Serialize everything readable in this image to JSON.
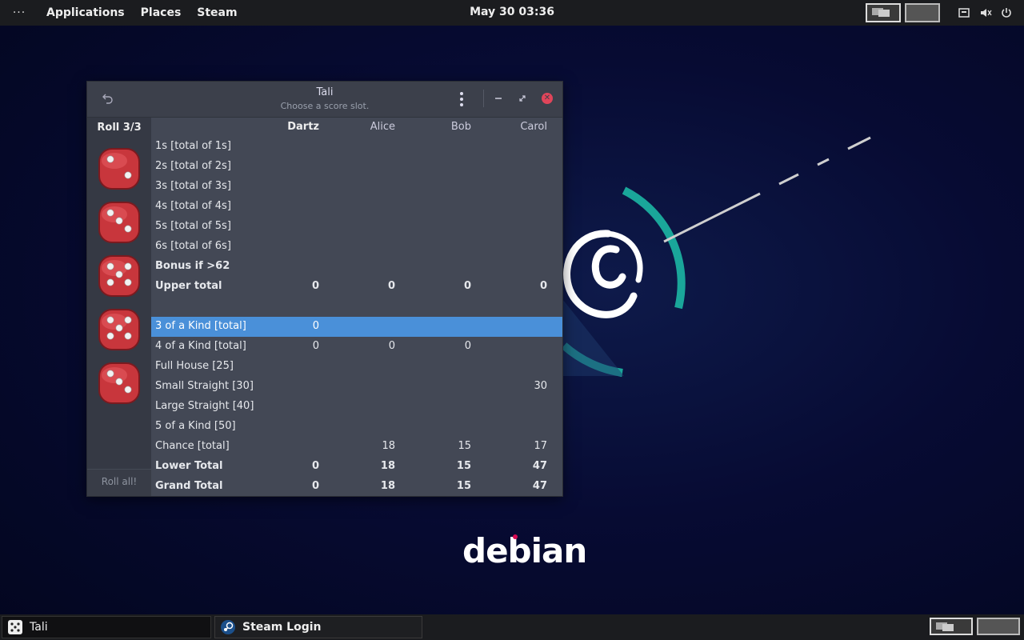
{
  "topbar": {
    "applications": "Applications",
    "places": "Places",
    "steam": "Steam",
    "clock": "May 30  03:36",
    "dots": "···"
  },
  "taskbar": {
    "tasks": [
      {
        "label": "Tali",
        "icon": "dice-icon"
      },
      {
        "label": "Steam Login",
        "icon": "steam-icon"
      }
    ]
  },
  "desktop": {
    "logo_text": "debian"
  },
  "window": {
    "title": "Tali",
    "subtitle": "Choose a score slot.",
    "roll_label": "Roll 3/3",
    "roll_all": "Roll all!",
    "players": [
      "Dartz",
      "Alice",
      "Bob",
      "Carol"
    ],
    "rows": [
      {
        "label": "1s [total of 1s]",
        "bold": false,
        "values": [
          "",
          "",
          "",
          ""
        ]
      },
      {
        "label": "2s [total of 2s]",
        "bold": false,
        "values": [
          "",
          "",
          "",
          ""
        ]
      },
      {
        "label": "3s [total of 3s]",
        "bold": false,
        "values": [
          "",
          "",
          "",
          ""
        ]
      },
      {
        "label": "4s [total of 4s]",
        "bold": false,
        "values": [
          "",
          "",
          "",
          ""
        ]
      },
      {
        "label": "5s [total of 5s]",
        "bold": false,
        "values": [
          "",
          "",
          "",
          ""
        ]
      },
      {
        "label": "6s [total of 6s]",
        "bold": false,
        "values": [
          "",
          "",
          "",
          ""
        ]
      },
      {
        "label": "Bonus if >62",
        "bold": true,
        "values": [
          "",
          "",
          "",
          ""
        ]
      },
      {
        "label": "Upper total",
        "bold": true,
        "values": [
          "0",
          "0",
          "0",
          "0"
        ]
      },
      {
        "label": "",
        "bold": false,
        "values": [
          "",
          "",
          "",
          ""
        ]
      },
      {
        "label": "3 of a Kind [total]",
        "bold": false,
        "selected": true,
        "values": [
          "0",
          "",
          "",
          ""
        ]
      },
      {
        "label": "4 of a Kind [total]",
        "bold": false,
        "values": [
          "0",
          "0",
          "0",
          ""
        ]
      },
      {
        "label": "Full House [25]",
        "bold": false,
        "values": [
          "",
          "",
          "",
          ""
        ]
      },
      {
        "label": "Small Straight [30]",
        "bold": false,
        "values": [
          "",
          "",
          "",
          "30"
        ]
      },
      {
        "label": "Large Straight [40]",
        "bold": false,
        "values": [
          "",
          "",
          "",
          ""
        ]
      },
      {
        "label": "5 of a Kind [50]",
        "bold": false,
        "values": [
          "",
          "",
          "",
          ""
        ]
      },
      {
        "label": "Chance [total]",
        "bold": false,
        "values": [
          "",
          "18",
          "15",
          "17"
        ]
      },
      {
        "label": "Lower Total",
        "bold": true,
        "values": [
          "0",
          "18",
          "15",
          "47"
        ]
      },
      {
        "label": "Grand Total",
        "bold": true,
        "values": [
          "0",
          "18",
          "15",
          "47"
        ]
      }
    ],
    "dice": [
      2,
      3,
      5,
      5,
      3
    ]
  },
  "colors": {
    "selection": "#4a90d9",
    "close": "#e0455a",
    "die": "#c8363c",
    "debian_red": "#d70a53",
    "swirl_teal": "#1aa69a"
  }
}
